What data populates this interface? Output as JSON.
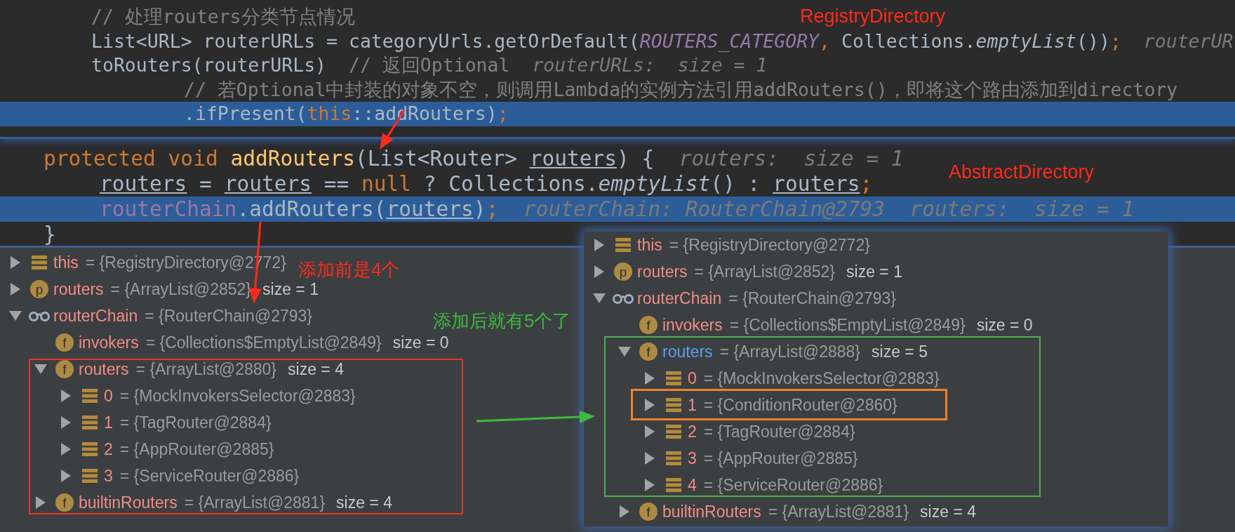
{
  "editor_top": {
    "lines": [
      {
        "highlighted": false,
        "tokens": [
          {
            "kind": "comment",
            "text": "// 处理routers分类节点情况"
          }
        ]
      },
      {
        "highlighted": false,
        "tokens": [
          {
            "kind": "plain",
            "text": "List<URL> routerURLs = categoryUrls.getOrDefault("
          },
          {
            "kind": "constant",
            "text": "ROUTERS_CATEGORY"
          },
          {
            "kind": "keyword",
            "text": ","
          },
          {
            "kind": "plain",
            "text": " Collections."
          },
          {
            "kind": "italic",
            "text": "emptyList"
          },
          {
            "kind": "plain",
            "text": "())"
          },
          {
            "kind": "keyword",
            "text": ";"
          },
          {
            "kind": "hint",
            "text": "  routerUR"
          }
        ]
      },
      {
        "highlighted": false,
        "tokens": [
          {
            "kind": "plain",
            "text": "toRouters(routerURLs)"
          },
          {
            "kind": "comment",
            "text": "  // 返回Optional"
          },
          {
            "kind": "hint",
            "text": "  routerURLs:  size = 1"
          }
        ]
      },
      {
        "highlighted": false,
        "tokens": [
          {
            "kind": "comment",
            "text": "// 若Optional中封装的对象不空，则调用Lambda的实例方法引用addRouters()，即将这个路由添加到directory"
          }
        ]
      },
      {
        "highlighted": true,
        "tokens": [
          {
            "kind": "plain",
            "text": ".ifPresent("
          },
          {
            "kind": "keyword",
            "text": "this"
          },
          {
            "kind": "plain",
            "text": "::addRouters)"
          },
          {
            "kind": "keyword",
            "text": ";"
          }
        ]
      }
    ]
  },
  "editor_bottom": {
    "lines": [
      {
        "highlighted": false,
        "tokens": [
          {
            "kind": "keyword",
            "text": "protected void "
          },
          {
            "kind": "method",
            "text": "addRouters"
          },
          {
            "kind": "plain",
            "text": "(List<Router> "
          },
          {
            "kind": "param",
            "text": "routers"
          },
          {
            "kind": "plain",
            "text": ") {"
          },
          {
            "kind": "hint",
            "text": "  routers:  size = 1"
          }
        ]
      },
      {
        "highlighted": false,
        "tokens": [
          {
            "kind": "param",
            "text": "routers"
          },
          {
            "kind": "plain",
            "text": " = "
          },
          {
            "kind": "param",
            "text": "routers"
          },
          {
            "kind": "plain",
            "text": " == "
          },
          {
            "kind": "keyword",
            "text": "null"
          },
          {
            "kind": "plain",
            "text": " ? Collections."
          },
          {
            "kind": "italic",
            "text": "emptyList"
          },
          {
            "kind": "plain",
            "text": "() : "
          },
          {
            "kind": "param",
            "text": "routers"
          },
          {
            "kind": "keyword",
            "text": ";"
          }
        ]
      },
      {
        "highlighted": true,
        "tokens": [
          {
            "kind": "field",
            "text": "routerChain"
          },
          {
            "kind": "plain",
            "text": ".addRouters("
          },
          {
            "kind": "param",
            "text": "routers"
          },
          {
            "kind": "plain",
            "text": ")"
          },
          {
            "kind": "keyword",
            "text": ";"
          },
          {
            "kind": "hint",
            "text": "  routerChain: RouterChain@2793  routers:  size = 1"
          }
        ]
      },
      {
        "highlighted": false,
        "tokens": [
          {
            "kind": "plain",
            "text": "}"
          }
        ]
      }
    ]
  },
  "variables_before": [
    {
      "kind": "stack",
      "name": "this",
      "value": "= {RegistryDirectory@2772}",
      "expanded": false,
      "changed": false
    },
    {
      "kind": "parameter",
      "letter": "p",
      "name": "routers",
      "value": "= {ArrayList@2852}",
      "size": "size = 1",
      "expanded": false,
      "changed": false
    },
    {
      "kind": "watch",
      "name": "routerChain",
      "value": "= {RouterChain@2793}",
      "expanded": true,
      "changed": false,
      "children": [
        {
          "kind": "field",
          "letter": "f",
          "name": "invokers",
          "value": "= {Collections$EmptyList@2849}",
          "size": "size = 0",
          "changed": false
        },
        {
          "kind": "field",
          "letter": "f",
          "name": "routers",
          "value": "= {ArrayList@2880}",
          "size": "size = 4",
          "expanded": true,
          "changed": false,
          "children": [
            {
              "kind": "stack",
              "name": "0",
              "value": "= {MockInvokersSelector@2883}",
              "expanded": false,
              "changed": false
            },
            {
              "kind": "stack",
              "name": "1",
              "value": "= {TagRouter@2884}",
              "expanded": false,
              "changed": false
            },
            {
              "kind": "stack",
              "name": "2",
              "value": "= {AppRouter@2885}",
              "expanded": false,
              "changed": false
            },
            {
              "kind": "stack",
              "name": "3",
              "value": "= {ServiceRouter@2886}",
              "expanded": false,
              "changed": false
            }
          ]
        },
        {
          "kind": "field",
          "letter": "f",
          "name": "builtinRouters",
          "value": "= {ArrayList@2881}",
          "size": "size = 4",
          "expanded": false,
          "changed": false
        }
      ]
    }
  ],
  "variables_after": [
    {
      "kind": "stack",
      "name": "this",
      "value": "= {RegistryDirectory@2772}",
      "expanded": false,
      "changed": false
    },
    {
      "kind": "parameter",
      "letter": "p",
      "name": "routers",
      "value": "= {ArrayList@2852}",
      "size": "size = 1",
      "expanded": false,
      "changed": false
    },
    {
      "kind": "watch",
      "name": "routerChain",
      "value": "= {RouterChain@2793}",
      "expanded": true,
      "changed": false,
      "children": [
        {
          "kind": "field",
          "letter": "f",
          "name": "invokers",
          "value": "= {Collections$EmptyList@2849}",
          "size": "size = 0",
          "changed": false
        },
        {
          "kind": "field",
          "letter": "f",
          "name": "routers",
          "value": "= {ArrayList@2888}",
          "size": "size = 5",
          "expanded": true,
          "changed": true,
          "children": [
            {
              "kind": "stack",
              "name": "0",
              "value": "= {MockInvokersSelector@2883}",
              "expanded": false,
              "changed": false
            },
            {
              "kind": "stack",
              "name": "1",
              "value": "= {ConditionRouter@2860}",
              "expanded": false,
              "changed": false
            },
            {
              "kind": "stack",
              "name": "2",
              "value": "= {TagRouter@2884}",
              "expanded": false,
              "changed": false
            },
            {
              "kind": "stack",
              "name": "3",
              "value": "= {AppRouter@2885}",
              "expanded": false,
              "changed": false
            },
            {
              "kind": "stack",
              "name": "4",
              "value": "= {ServiceRouter@2886}",
              "expanded": false,
              "changed": false
            }
          ]
        },
        {
          "kind": "field",
          "letter": "f",
          "name": "builtinRouters",
          "value": "= {ArrayList@2881}",
          "size": "size = 4",
          "expanded": false,
          "changed": false
        }
      ]
    }
  ],
  "annotations": [
    {
      "text": "RegistryDirectory",
      "color": "#ff2a1a"
    },
    {
      "text": "AbstractDirectory",
      "color": "#ff2a1a"
    },
    {
      "text": "添加前是4个",
      "color": "#ff2a1a"
    },
    {
      "text": "添加后就有5个了",
      "color": "#3dba3d"
    }
  ]
}
